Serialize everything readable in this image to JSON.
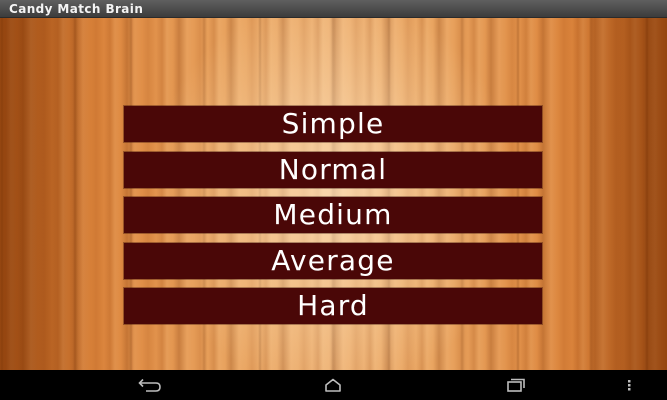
{
  "app": {
    "title": "Candy Match Brain"
  },
  "menu": {
    "items": [
      {
        "label": "Simple"
      },
      {
        "label": "Normal"
      },
      {
        "label": "Medium"
      },
      {
        "label": "Average"
      },
      {
        "label": "Hard"
      }
    ]
  },
  "navbar": {
    "icons": [
      "back-icon",
      "home-icon",
      "recent-apps-icon",
      "overflow-menu-icon"
    ]
  },
  "colors": {
    "title_bar": "#4a4a4a",
    "button_bg": "#4a0707",
    "button_text": "#ffffff",
    "wood_light": "#eeb275",
    "wood_dark": "#c9671f",
    "nav_bar": "#000000"
  }
}
